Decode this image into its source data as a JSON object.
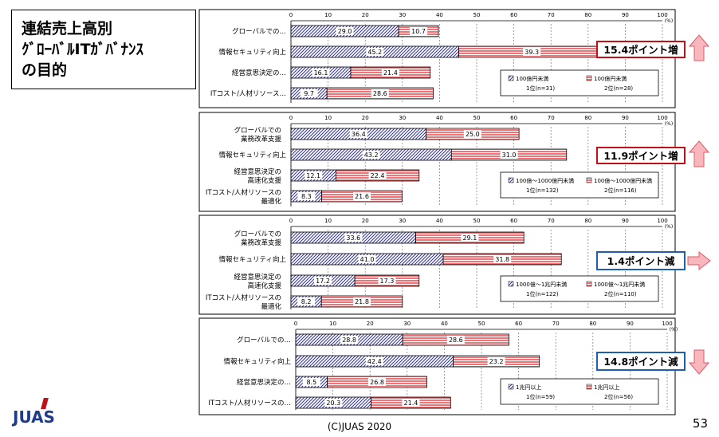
{
  "slide": {
    "title_line1": "連結売上高別",
    "title_line2": "ｸﾞﾛｰﾊﾞﾙITｶﾞﾊﾞﾅﾝｽ",
    "title_line3": "の目的",
    "logo": "JUAS",
    "footer": "(C)JUAS 2020",
    "page_number": "53"
  },
  "chart_data": [
    {
      "type": "bar",
      "orientation": "horizontal",
      "stacked": true,
      "x_ticks": [
        "0",
        "10",
        "20",
        "30",
        "40",
        "50",
        "60",
        "70",
        "80",
        "90",
        "100"
      ],
      "unit": "(%)",
      "xlim": [
        0,
        100
      ],
      "categories": [
        [
          "グローバルでの…"
        ],
        [
          "情報セキュリティ向上"
        ],
        [
          "経営意思決定の…"
        ],
        [
          "ITコスト/人材リソース…"
        ]
      ],
      "series": [
        {
          "values": [
            29.0,
            45.2,
            16.1,
            9.7
          ],
          "labels": [
            "29.0",
            "45.2",
            "16.1",
            "9.7"
          ],
          "fill": "#2e2eb0",
          "pattern": "diag"
        },
        {
          "values": [
            10.7,
            39.3,
            21.4,
            28.6
          ],
          "labels": [
            "10.7",
            "39.3",
            "21.4",
            "28.6"
          ],
          "fill": "#e8383d",
          "pattern": "horiz"
        }
      ],
      "legend_left": [
        "100億円未満",
        "1位(n=31)"
      ],
      "legend_right": [
        "100億円未満",
        "2位(n=28)"
      ],
      "callout": {
        "text": "15.4ポイント増",
        "color": "#c0101a",
        "arrow": "up"
      }
    },
    {
      "type": "bar",
      "orientation": "horizontal",
      "stacked": true,
      "x_ticks": [
        "0",
        "10",
        "20",
        "30",
        "40",
        "50",
        "60",
        "70",
        "80",
        "90",
        "100"
      ],
      "unit": "(%)",
      "xlim": [
        0,
        100
      ],
      "categories": [
        [
          "グローバルでの",
          "業務改革支援"
        ],
        [
          "情報セキュリティ向上"
        ],
        [
          "経営意思決定の",
          "高速化支援"
        ],
        [
          "ITコスト/人材リソースの",
          "最適化"
        ]
      ],
      "series": [
        {
          "values": [
            36.4,
            43.2,
            12.1,
            8.3
          ],
          "labels": [
            "36.4",
            "43.2",
            "12.1",
            "8.3"
          ],
          "fill": "#2e2eb0",
          "pattern": "diag"
        },
        {
          "values": [
            25.0,
            31.0,
            22.4,
            21.6
          ],
          "labels": [
            "25.0",
            "31.0",
            "22.4",
            "21.6"
          ],
          "fill": "#e8383d",
          "pattern": "horiz"
        }
      ],
      "legend_left": [
        "100億～1000億円未満",
        "1位(n=132)"
      ],
      "legend_right": [
        "100億～1000億円未満",
        "2位(n=116)"
      ],
      "callout": {
        "text": "11.9ポイント増",
        "color": "#c0101a",
        "arrow": "up"
      }
    },
    {
      "type": "bar",
      "orientation": "horizontal",
      "stacked": true,
      "x_ticks": [
        "0",
        "10",
        "20",
        "30",
        "40",
        "50",
        "60",
        "70",
        "80",
        "90",
        "100"
      ],
      "unit": "(%)",
      "xlim": [
        0,
        100
      ],
      "categories": [
        [
          "グローバルでの",
          "業務改革支援"
        ],
        [
          "情報セキュリティ向上"
        ],
        [
          "経営意思決定の",
          "高速化支援"
        ],
        [
          "ITコスト/人材リソースの",
          "最適化"
        ]
      ],
      "series": [
        {
          "values": [
            33.6,
            41.0,
            17.2,
            8.2
          ],
          "labels": [
            "33.6",
            "41.0",
            "17.2",
            "8.2"
          ],
          "fill": "#2e2eb0",
          "pattern": "diag"
        },
        {
          "values": [
            29.1,
            31.8,
            17.3,
            21.8
          ],
          "labels": [
            "29.1",
            "31.8",
            "17.3",
            "21.8"
          ],
          "fill": "#e8383d",
          "pattern": "horiz"
        }
      ],
      "legend_left": [
        "1000億～1兆円未満",
        "1位(n=122)"
      ],
      "legend_right": [
        "1000億～1兆円未満",
        "2位(n=110)"
      ],
      "callout": {
        "text": "1.4ポイント減",
        "color": "#1f5fb0",
        "arrow": "right"
      }
    },
    {
      "type": "bar",
      "orientation": "horizontal",
      "stacked": true,
      "x_ticks": [
        "0",
        "10",
        "20",
        "30",
        "40",
        "50",
        "60",
        "70",
        "80",
        "90",
        "100"
      ],
      "unit": "(%)",
      "xlim": [
        0,
        100
      ],
      "categories": [
        [
          "グローバルでの…"
        ],
        [
          "情報セキュリティ向上"
        ],
        [
          "経営意思決定の…"
        ],
        [
          "ITコスト/人材リソースの…"
        ]
      ],
      "series": [
        {
          "values": [
            28.8,
            42.4,
            8.5,
            20.3
          ],
          "labels": [
            "28.8",
            "42.4",
            "8.5",
            "20.3"
          ],
          "fill": "#2e2eb0",
          "pattern": "diag"
        },
        {
          "values": [
            28.6,
            23.2,
            26.8,
            21.4
          ],
          "labels": [
            "28.6",
            "23.2",
            "26.8",
            "21.4"
          ],
          "fill": "#e8383d",
          "pattern": "horiz"
        }
      ],
      "legend_left": [
        "1兆円以上",
        "1位(n=59)"
      ],
      "legend_right": [
        "1兆円以上",
        "2位(n=56)"
      ],
      "callout": {
        "text": "14.8ポイント減",
        "color": "#1f5fb0",
        "arrow": "down"
      }
    }
  ]
}
